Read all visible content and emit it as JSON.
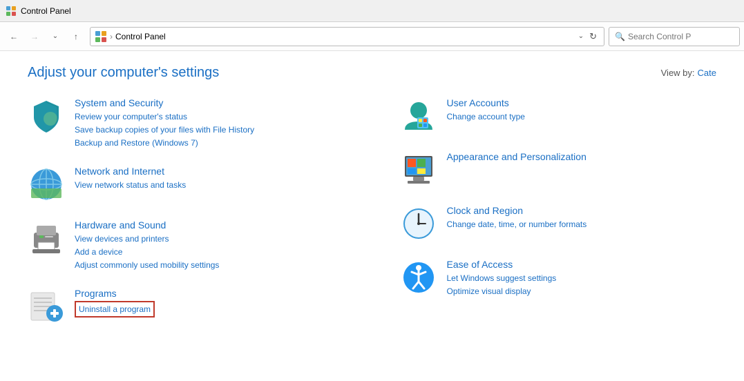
{
  "titlebar": {
    "icon": "control-panel-icon",
    "title": "Control Panel"
  },
  "navbar": {
    "back_disabled": false,
    "forward_disabled": true,
    "address": "Control Panel",
    "search_placeholder": "Search Control P"
  },
  "page": {
    "heading": "Adjust your computer's settings",
    "viewby_label": "View by:",
    "viewby_value": "Cate"
  },
  "categories": [
    {
      "id": "system-security",
      "title": "System and Security",
      "links": [
        "Review your computer's status",
        "Save backup copies of your files with File History",
        "Backup and Restore (Windows 7)"
      ],
      "highlighted_link": null
    },
    {
      "id": "network-internet",
      "title": "Network and Internet",
      "links": [
        "View network status and tasks"
      ],
      "highlighted_link": null
    },
    {
      "id": "hardware-sound",
      "title": "Hardware and Sound",
      "links": [
        "View devices and printers",
        "Add a device",
        "Adjust commonly used mobility settings"
      ],
      "highlighted_link": null
    },
    {
      "id": "programs",
      "title": "Programs",
      "links": [],
      "highlighted_link": "Uninstall a program"
    }
  ],
  "right_categories": [
    {
      "id": "user-accounts",
      "title": "User Accounts",
      "links": [
        "Change account type"
      ],
      "highlighted_link": null
    },
    {
      "id": "appearance",
      "title": "Appearance and Personalization",
      "links": [],
      "highlighted_link": null
    },
    {
      "id": "clock-region",
      "title": "Clock and Region",
      "links": [
        "Change date, time, or number formats"
      ],
      "highlighted_link": null
    },
    {
      "id": "ease-access",
      "title": "Ease of Access",
      "links": [
        "Let Windows suggest settings",
        "Optimize visual display"
      ],
      "highlighted_link": null
    }
  ]
}
